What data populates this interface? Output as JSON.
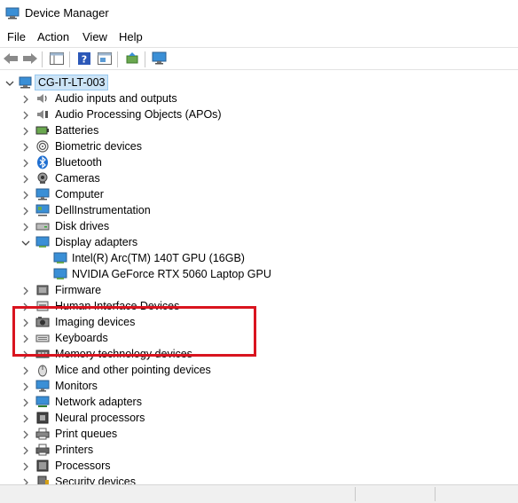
{
  "window": {
    "title": "Device Manager"
  },
  "menu": [
    "File",
    "Action",
    "View",
    "Help"
  ],
  "toolbar": {
    "buttons": [
      "back-arrow-icon",
      "forward-arrow-icon",
      "show-hide-console-tree-icon",
      "help-icon",
      "properties-icon",
      "update-driver-icon",
      "scan-hardware-icon"
    ]
  },
  "tree": {
    "root": "CG-IT-LT-003",
    "categories": [
      "Audio inputs and outputs",
      "Audio Processing Objects (APOs)",
      "Batteries",
      "Biometric devices",
      "Bluetooth",
      "Cameras",
      "Computer",
      "DellInstrumentation",
      "Disk drives",
      "Display adapters",
      "Firmware",
      "Human Interface Devices",
      "Imaging devices",
      "Keyboards",
      "Memory technology devices",
      "Mice and other pointing devices",
      "Monitors",
      "Network adapters",
      "Neural processors",
      "Print queues",
      "Printers",
      "Processors",
      "Security devices"
    ],
    "display_adapters": [
      "Intel(R) Arc(TM) 140T GPU (16GB)",
      "NVIDIA GeForce RTX 5060 Laptop GPU"
    ]
  },
  "colors": {
    "highlight_border": "#d9141f",
    "selection": "#cce4f7",
    "accent": "#0078d4"
  }
}
